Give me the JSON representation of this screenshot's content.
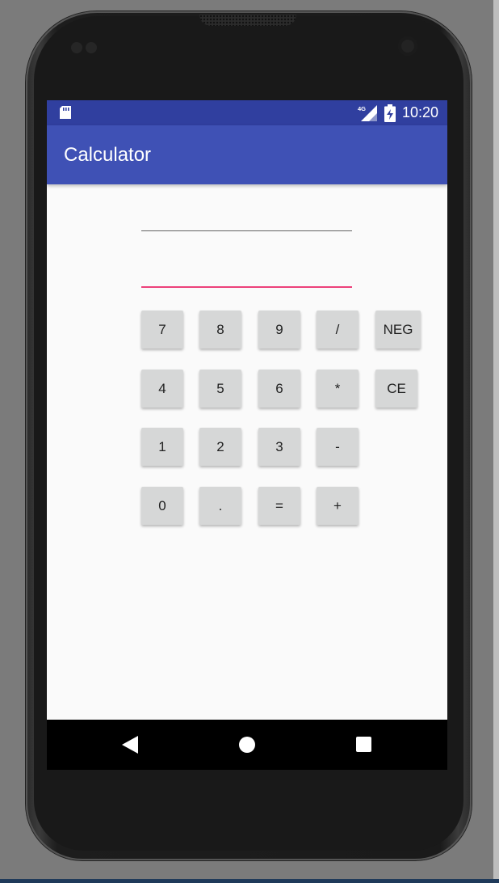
{
  "status_bar": {
    "time": "10:20",
    "network": "4G",
    "icons": [
      "sd-card-icon",
      "signal-icon",
      "battery-charging-icon"
    ]
  },
  "app": {
    "title": "Calculator",
    "colors": {
      "status_bar": "#303f9f",
      "app_bar": "#3f51b5",
      "accent": "#ec407a",
      "key": "#d6d7d7"
    }
  },
  "display": {
    "result_value": "",
    "input_value": ""
  },
  "keypad": {
    "rows": [
      [
        "7",
        "8",
        "9",
        "/",
        "NEG"
      ],
      [
        "4",
        "5",
        "6",
        "*",
        "CE"
      ],
      [
        "1",
        "2",
        "3",
        "-"
      ],
      [
        "0",
        ".",
        "=",
        "+"
      ]
    ]
  },
  "nav_bar": {
    "icons": [
      "back-icon",
      "home-icon",
      "recents-icon"
    ]
  }
}
